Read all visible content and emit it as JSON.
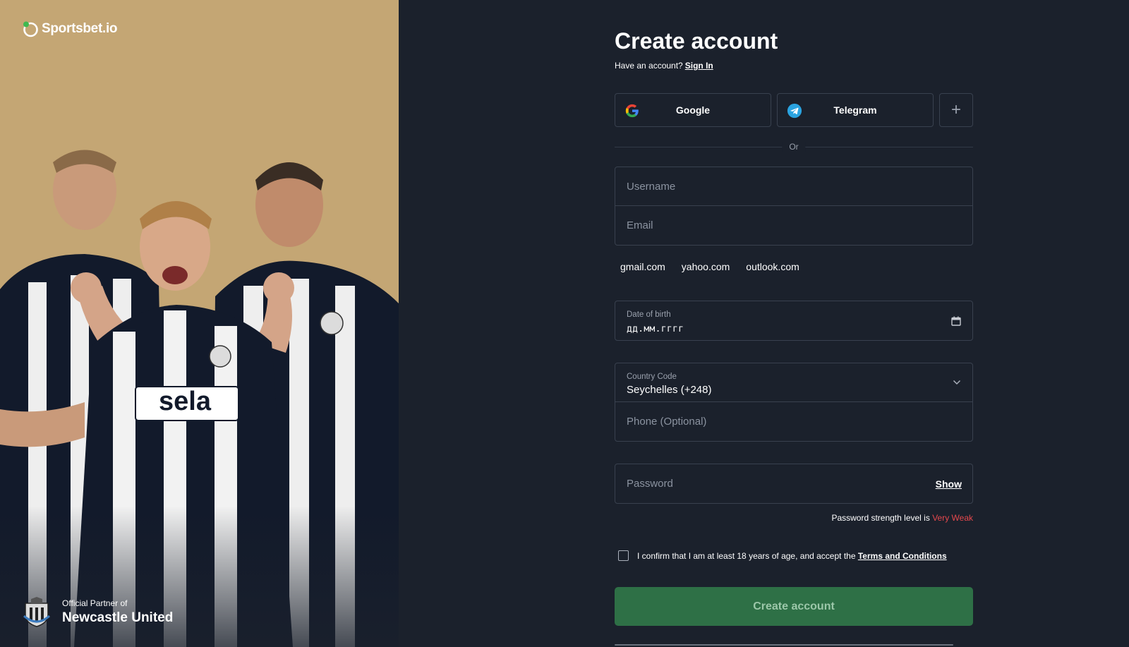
{
  "brand": {
    "name": "Sportsbet.io"
  },
  "promo": {
    "partner_line": "Official Partner of",
    "partner_club": "Newcastle United",
    "shirt_sponsor": "sela",
    "bg_color": "#c4a674"
  },
  "form": {
    "title": "Create account",
    "have_account": "Have an account?",
    "sign_in": "Sign In",
    "social": {
      "google": "Google",
      "telegram": "Telegram",
      "more": "+"
    },
    "or": "Or",
    "username_placeholder": "Username",
    "email_placeholder": "Email",
    "email_domains": [
      "gmail.com",
      "yahoo.com",
      "outlook.com"
    ],
    "dob_label": "Date of birth",
    "dob_value": "дд.мм.гггг",
    "country_label": "Country Code",
    "country_value": "Seychelles (+248)",
    "phone_placeholder": "Phone (Optional)",
    "password_placeholder": "Password",
    "show_label": "Show",
    "strength_prefix": "Password strength level is",
    "strength_value": "Very Weak",
    "consent_text": "I confirm that I am at least 18 years of age, and accept the",
    "terms_link": "Terms and Conditions",
    "consent_checked": false,
    "submit": "Create account"
  },
  "colors": {
    "page_bg": "#1b212c",
    "submit_bg": "#2e7046",
    "weak": "#e5484d",
    "brand_green": "#3fb950"
  }
}
